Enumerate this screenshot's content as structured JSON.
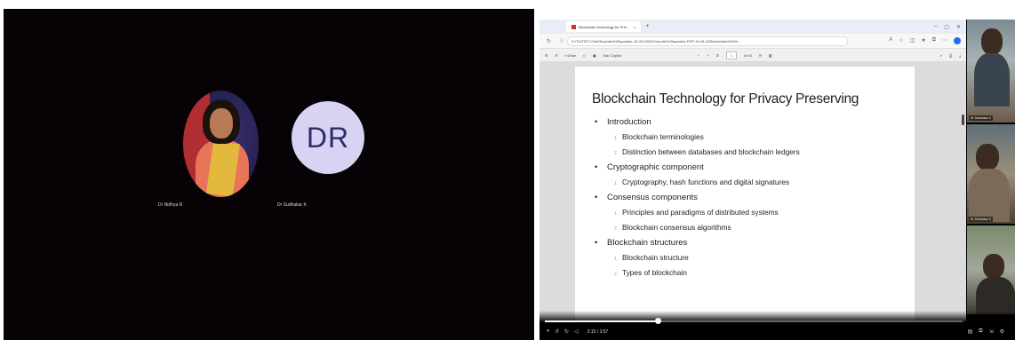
{
  "meeting": {
    "participants": [
      {
        "name": "Dr Nidhya R",
        "avatar": "photo"
      },
      {
        "name": "Dr Sudhakar K",
        "initials": "DR"
      }
    ]
  },
  "browser": {
    "tab_title": "Blockchain technology for Priv...",
    "tab_close": "×",
    "new_tab": "+",
    "url": "D:/TU/TIET-Chitti/Keynote%20speaker-15-06-2022/Keynote%20speaker-FDP-15-06-22/Blockchain%20te...",
    "pdf_toolbar": {
      "draw_label": "Draw",
      "ask_label": "Ask Copilot",
      "page_current": "1",
      "page_total": "of 40"
    }
  },
  "slide": {
    "title": "Blockchain Technology for Privacy Preserving",
    "sections": [
      {
        "label": "Introduction",
        "items": [
          "Blockchain terminologies",
          "Distinction between databases and blockchain ledgers"
        ]
      },
      {
        "label": "Cryptographic component",
        "items": [
          "Cryptography, hash functions and digital signatures"
        ]
      },
      {
        "label": "Consensus components",
        "items": [
          "Principles and paradigms of distributed systems",
          "Blockchain consensus algorithms"
        ]
      },
      {
        "label": "Blockchain structures",
        "items": [
          "Blockchain structure",
          "Types of blockchain"
        ]
      }
    ]
  },
  "video": {
    "time": "2:15 / 3:57",
    "progress": 0.27
  },
  "thumbnails": [
    {
      "label": "Dr Sudhakar K"
    },
    {
      "label": "Dr Sudhakar K"
    },
    {
      "label": ""
    }
  ],
  "colors": {
    "meeting_bg": "#060205",
    "initials_bg": "#d8d3f2",
    "initials_text": "#2c2c66",
    "pdf_accent": "#d93025"
  }
}
